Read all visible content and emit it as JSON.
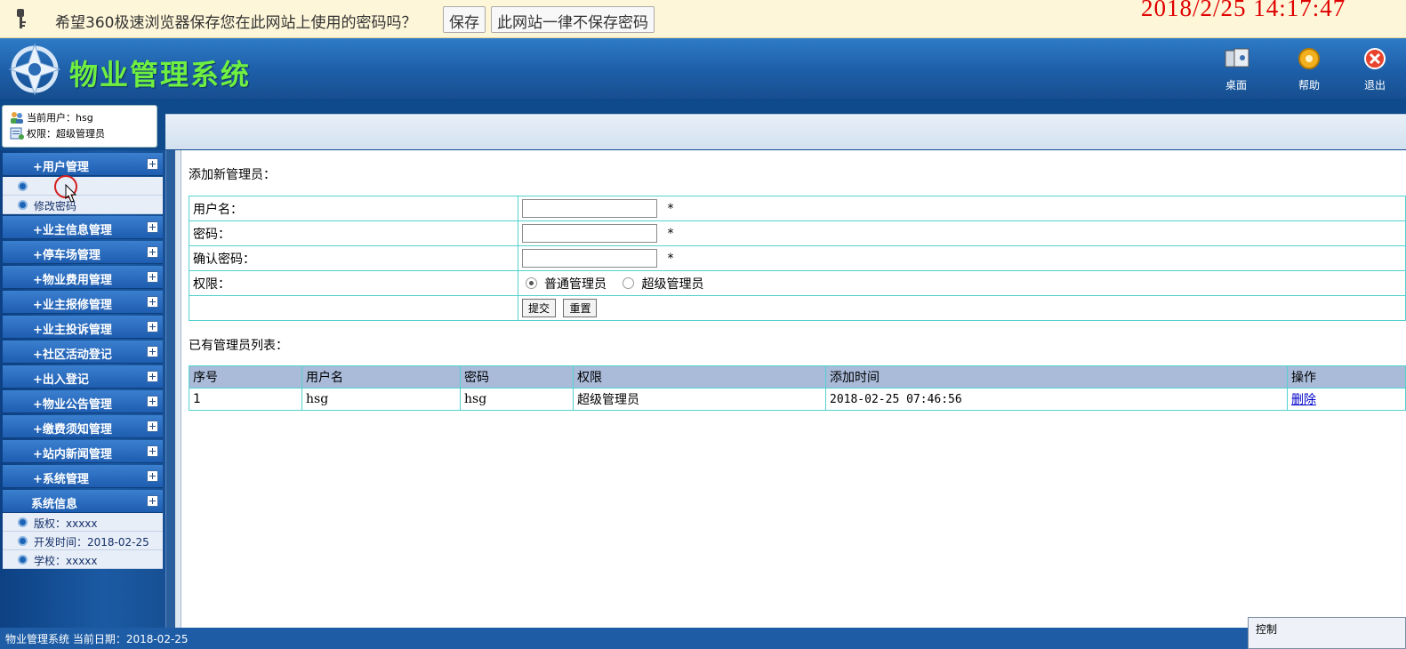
{
  "browser_bar": {
    "message": "希望360极速浏览器保存您在此网站上使用的密码吗？",
    "save_button": "保存",
    "never_button": "此网站一律不保存密码"
  },
  "clock": "2018/2/25  14:17:47",
  "header": {
    "title": "物业管理系统",
    "tools": [
      {
        "label": "桌面",
        "icon": "desktop-icon"
      },
      {
        "label": "帮助",
        "icon": "help-icon"
      },
      {
        "label": "退出",
        "icon": "exit-icon"
      }
    ]
  },
  "user": {
    "current_user": "当前用户：hsg",
    "role": "权限：超级管理员"
  },
  "sidebar": {
    "user_menu": "+用户管理",
    "user_sub": [
      "",
      "修改密码"
    ],
    "menus": [
      "+业主信息管理",
      "+停车场管理",
      "+物业费用管理",
      "+业主报修管理",
      "+业主投诉管理",
      "+社区活动登记",
      "+出入登记",
      "+物业公告管理",
      "+缴费须知管理",
      "+站内新闻管理",
      "+系统管理"
    ],
    "sysinfo_title": "系统信息",
    "sysinfo": [
      "版权：xxxxx",
      "开发时间：2018-02-25",
      "学校：xxxxx"
    ]
  },
  "form": {
    "section_title": "添加新管理员：",
    "username_label": "用户名：",
    "password_label": "密码：",
    "confirm_label": "确认密码：",
    "role_label": "权限：",
    "required_mark": "*",
    "role_options": [
      "普通管理员",
      "超级管理员"
    ],
    "role_selected": "普通管理员",
    "submit": "提交",
    "reset": "重置"
  },
  "admin_list": {
    "section_title": "已有管理员列表：",
    "columns": [
      "序号",
      "用户名",
      "密码",
      "权限",
      "添加时间",
      "操作"
    ],
    "rows": [
      [
        "1",
        "hsg",
        "hsg",
        "超级管理员",
        "2018-02-25 07:46:56",
        "删除"
      ]
    ]
  },
  "footer": "物业管理系统 当前日期：2018-02-25",
  "control_window": "控制"
}
